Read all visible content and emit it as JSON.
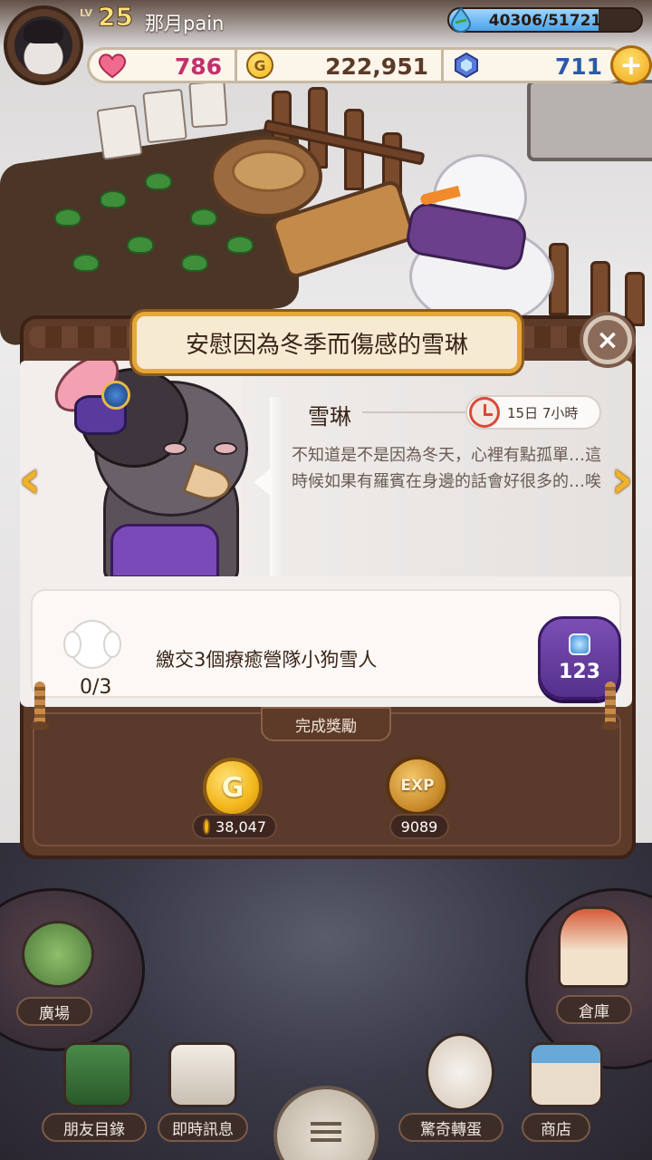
{
  "player": {
    "level_prefix": "LV",
    "level": "25",
    "name": "那月pain",
    "exp_text": "40306/51721",
    "exp_fraction": 0.779
  },
  "resources": {
    "hearts": "786",
    "coins": "222,951",
    "gems": "711",
    "plus_label": "+"
  },
  "quest": {
    "title": "安慰因為冬季而傷感的雪琳",
    "close_label": "×",
    "npc_name": "雪琳",
    "timer": "15日 7小時",
    "description": "不知道是不是因為冬天，心裡有點孤單…這時候如果有羅賓在身邊的話會好很多的…唉",
    "prev_label": "‹",
    "next_label": "›",
    "task": {
      "progress": "0/3",
      "text": "繳交3個療癒營隊小狗雪人",
      "gem_cost": "123"
    },
    "rewards_title": "完成獎勵",
    "rewards": {
      "coin_icon_label": "G",
      "coin_amount": "38,047",
      "exp_icon_label": "EXP",
      "exp_amount": "9089"
    }
  },
  "bottom_nav": {
    "plaza": "廣場",
    "warehouse": "倉庫",
    "friends": "朋友目錄",
    "messages": "即時訊息",
    "gacha": "驚奇轉蛋",
    "shop": "商店"
  },
  "colors": {
    "accent_gold": "#f2b12a",
    "heart_text": "#c0306a",
    "coin_text": "#5a3a28",
    "gem_text": "#2a5aa8",
    "panel_brown": "#5e3b29",
    "gem_button": "#6a42a6"
  },
  "icons": {
    "hearts": "heart-icon",
    "coins": "coin-icon",
    "gems": "gem-icon",
    "exp": "water-drop-icon",
    "timer": "alarm-clock-icon",
    "task": "puppy-snowman-icon",
    "menu": "hamburger-menu-icon"
  }
}
